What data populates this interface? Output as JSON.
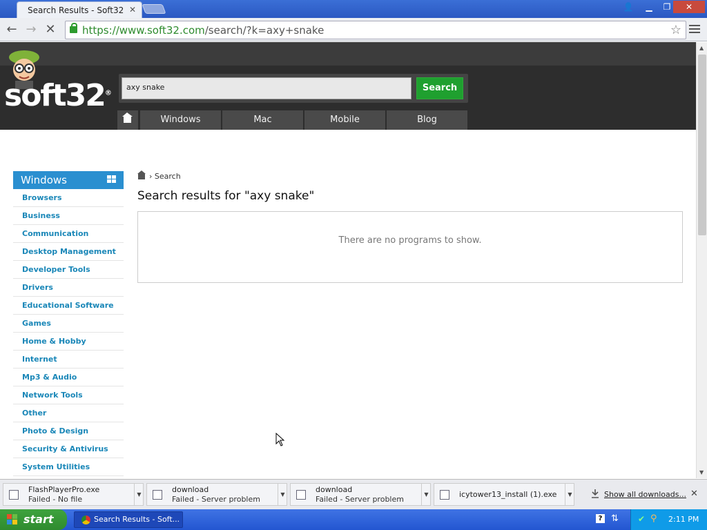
{
  "browser": {
    "tab_title": "Search Results - Soft32",
    "url_host": "https://www.soft32.com",
    "url_path": "/search/?k=axy+snake"
  },
  "site": {
    "logo": "soft32",
    "search_value": "axy snake",
    "search_button": "Search",
    "nav": [
      "Windows",
      "Mac",
      "Mobile",
      "Blog"
    ]
  },
  "sidebar": {
    "title": "Windows",
    "items": [
      "Browsers",
      "Business",
      "Communication",
      "Desktop Management",
      "Developer Tools",
      "Drivers",
      "Educational Software",
      "Games",
      "Home & Hobby",
      "Internet",
      "Mp3 & Audio",
      "Network Tools",
      "Other",
      "Photo & Design",
      "Security & Antivirus",
      "System Utilities"
    ]
  },
  "main": {
    "breadcrumb": "Search",
    "results_title": "Search results for \"axy snake\"",
    "empty_message": "There are no programs to show."
  },
  "downloads": {
    "items": [
      {
        "name": "FlashPlayerPro.exe",
        "status": "Failed - No file"
      },
      {
        "name": "download",
        "status": "Failed - Server problem"
      },
      {
        "name": "download",
        "status": "Failed - Server problem"
      },
      {
        "name": "icytower13_install (1).exe",
        "status": ""
      }
    ],
    "show_all": "Show all downloads..."
  },
  "taskbar": {
    "start": "start",
    "task": "Search Results - Soft...",
    "time": "2:11 PM"
  },
  "colors": {
    "accent": "#2a8fd0",
    "search_green": "#1fa02f",
    "header_dark": "#2d2d2d"
  }
}
